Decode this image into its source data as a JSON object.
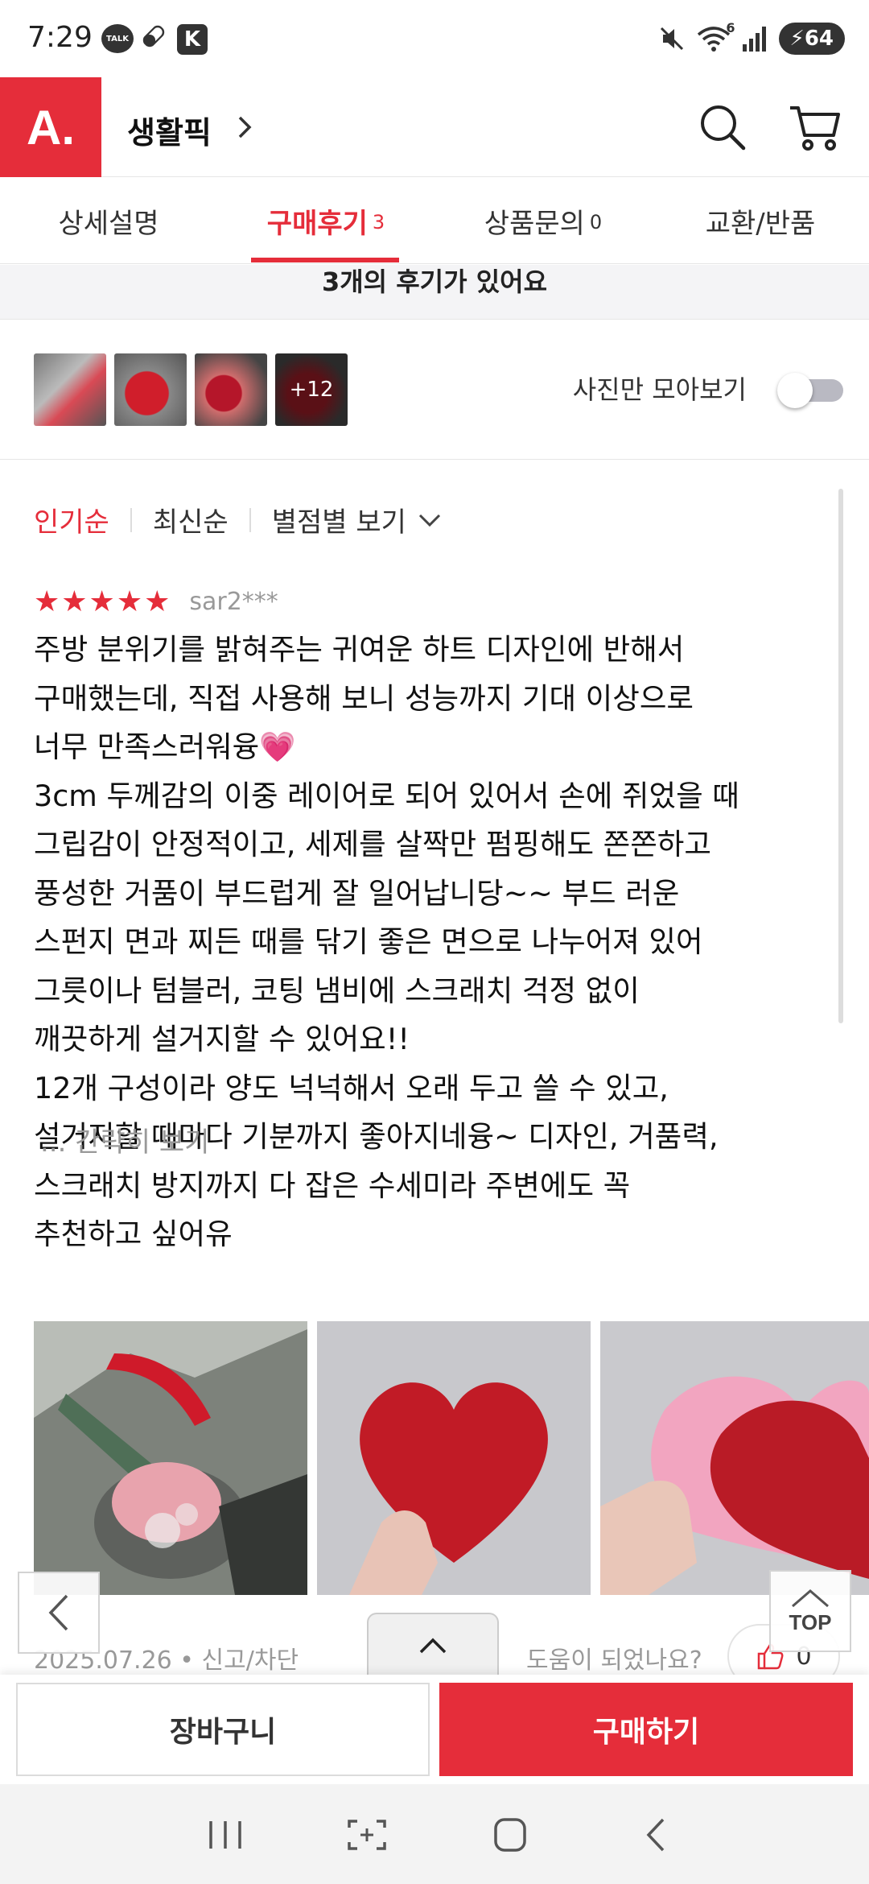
{
  "status_bar": {
    "time": "7:29",
    "talk_badge": "TALK",
    "k_badge": "K",
    "wifi_label": "6",
    "battery": "64"
  },
  "header": {
    "logo": "A.",
    "title": "생활픽",
    "icons": [
      "search-icon",
      "cart-icon",
      "chevron-right-icon"
    ]
  },
  "tabs": [
    {
      "label": "상세설명",
      "count": ""
    },
    {
      "label": "구매후기",
      "count": "3"
    },
    {
      "label": "상품문의",
      "count": "0"
    },
    {
      "label": "교환/반품",
      "count": ""
    }
  ],
  "active_tab_index": 1,
  "reviews": {
    "count_banner": "3개의 후기가 있어요",
    "thumbnails": [
      {
        "overlay": ""
      },
      {
        "overlay": ""
      },
      {
        "overlay": ""
      },
      {
        "overlay": "+12"
      }
    ],
    "photo_only_label": "사진만 모아보기",
    "photo_only_enabled": false,
    "sort": {
      "popular": "인기순",
      "latest": "최신순",
      "by_rating": "별점별 보기"
    },
    "item": {
      "stars": "★★★★★",
      "rating": 5,
      "author": "sar2***",
      "body": "주방 분위기를 밝혀주는 귀여운 하트 디자인에 반해서\n구매했는데, 직접 사용해 보니 성능까지 기대 이상으로\n너무 만족스러워융💗\n3cm 두께감의 이중 레이어로 되어 있어서 손에 쥐었을 때\n그립감이 안정적이고, 세제를 살짝만 펌핑해도 쫀쫀하고\n풍성한 거품이 부드럽게 잘 일어납니당~~ 부드 러운\n스펀지 면과 찌든 때를 닦기 좋은 면으로 나누어져 있어\n그릇이나 텀블러, 코팅 냄비에 스크래치 걱정 없이\n깨끗하게 설거지할 수 있어요!!\n12개 구성이라 양도 넉넉해서 오래 두고 쓸 수 있고,\n설거지할 때마다 기분까지 좋아지네융~ 디자인, 거품력,\n스크래치 방지까지 다 잡은 수세미라 주변에도 꼭\n추천하고 싶어유",
      "collapse_label": "... 간략히 보기",
      "meta": "2025.07.26 • 신고/차단",
      "helpful_question": "도움이 되었나요?",
      "helpful_count": "0"
    }
  },
  "floating": {
    "top_label": "TOP"
  },
  "bottom_bar": {
    "cart_label": "장바구니",
    "buy_label": "구매하기"
  },
  "colors": {
    "accent": "#e52d3a",
    "text": "#222222",
    "muted": "#999999"
  }
}
